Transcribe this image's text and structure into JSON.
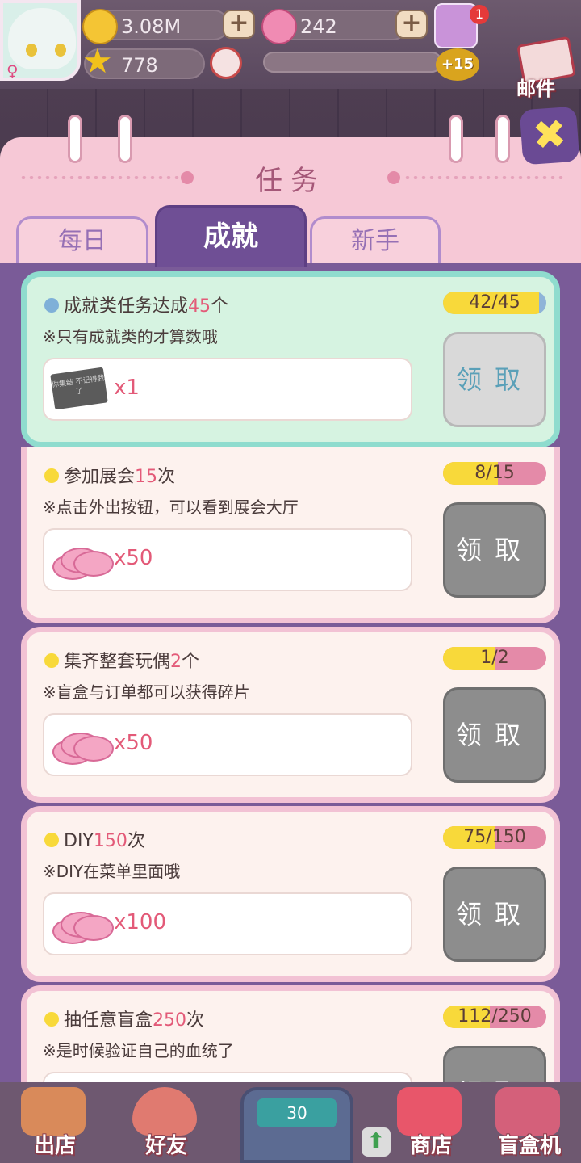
{
  "header": {
    "gold": "3.08M",
    "gems": "242",
    "stars": "778",
    "notif_count": "1",
    "level_bonus": "+15",
    "mail_label": "邮件"
  },
  "panel": {
    "title": "任务",
    "tabs": [
      {
        "label": "每日",
        "active": false
      },
      {
        "label": "成就",
        "active": true
      },
      {
        "label": "新手",
        "active": false
      }
    ]
  },
  "tasks": [
    {
      "title_pre": "成就类任务达成",
      "num": "45",
      "title_post": "个",
      "tip": "※只有成就类的才算数哦",
      "reward_card_text": "你集结 不记得我了",
      "reward_qty": "x1",
      "progress": "42/45",
      "fill": 0.93,
      "claim": "领取",
      "done": true
    },
    {
      "title_pre": "参加展会",
      "num": "15",
      "title_post": "次",
      "tip": "※点击外出按钮，可以看到展会大厅",
      "reward_qty": "x50",
      "progress": "8/15",
      "fill": 0.53,
      "claim": "领取",
      "done": false
    },
    {
      "title_pre": "集齐整套玩偶",
      "num": "2",
      "title_post": "个",
      "tip": "※盲盒与订单都可以获得碎片",
      "reward_qty": "x50",
      "progress": "1/2",
      "fill": 0.5,
      "claim": "领取",
      "done": false
    },
    {
      "title_pre": "DIY",
      "num": "150",
      "title_post": "次",
      "tip": "※DIY在菜单里面哦",
      "reward_qty": "x100",
      "progress": "75/150",
      "fill": 0.5,
      "claim": "领取",
      "done": false
    },
    {
      "title_pre": "抽任意盲盒",
      "num": "250",
      "title_post": "次",
      "tip": "※是时候验证自己的血统了",
      "reward_qty": "",
      "progress": "112/250",
      "fill": 0.45,
      "claim": "领取",
      "done": false
    }
  ],
  "bottom_nav": {
    "items": [
      {
        "label": "出店"
      },
      {
        "label": "好友"
      },
      {
        "label": "商店"
      },
      {
        "label": "盲盒机"
      }
    ],
    "center_value": "30"
  }
}
